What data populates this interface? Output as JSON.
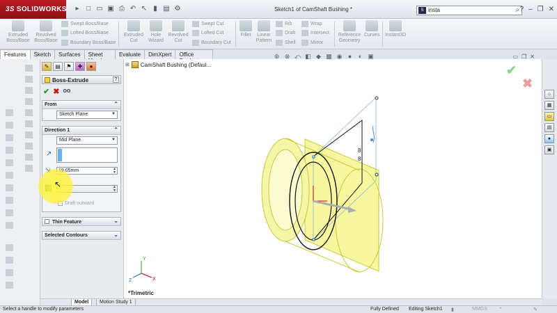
{
  "app": {
    "brand_prefix": "3S",
    "brand_name": "SOLIDWORKS",
    "document_title": "Sketch1 of CamShaft Bushing *",
    "search_value": "insta",
    "search_badge": "S"
  },
  "ribbon": {
    "extruded_boss": "Extruded Boss/Base",
    "revolved_boss": "Revolved Boss/Base",
    "swept_boss": "Swept Boss/Base",
    "lofted_boss": "Lofted Boss/Base",
    "boundary_boss": "Boundary Boss/Base",
    "extruded_cut": "Extruded Cut",
    "hole_wizard": "Hole Wizard",
    "revolved_cut": "Revolved Cut",
    "swept_cut": "Swept Cut",
    "lofted_cut": "Lofted Cut",
    "boundary_cut": "Boundary Cut",
    "fillet": "Fillet",
    "linear_pattern": "Linear Pattern",
    "rib": "Rib",
    "draft": "Draft",
    "shell": "Shell",
    "wrap": "Wrap",
    "intersect": "Intersect",
    "mirror": "Mirror",
    "reference_geometry": "Reference Geometry",
    "curves": "Curves",
    "instant3d": "Instant3D"
  },
  "tabs": [
    "Features",
    "Sketch",
    "Surfaces",
    "Sheet Metal",
    "Evaluate",
    "DimXpert",
    "Office Products"
  ],
  "property_manager": {
    "title": "Boss-Extrude",
    "help": "?",
    "from": {
      "label": "From",
      "value": "Sketch Plane"
    },
    "direction1": {
      "label": "Direction 1",
      "end_condition": "Mid Plane",
      "depth": "19.05mm",
      "draft_label": "Draft outward"
    },
    "thin_feature": "Thin Feature",
    "selected_contours": "Selected Contours"
  },
  "viewport": {
    "tree_label": "CamShaft Bushing  (Defaul...",
    "view_orientation": "*Trimetric"
  },
  "bottom_tabs": [
    "Model",
    "Motion Study 1"
  ],
  "status": {
    "message": "Select a handle to modify parameters",
    "state": "Fully Defined",
    "editing": "Editing Sketch1",
    "units": "MMGS"
  },
  "colors": {
    "accent": "#b81c22",
    "part_fill": "#f7f7a0",
    "part_edge": "#c9c93a"
  }
}
